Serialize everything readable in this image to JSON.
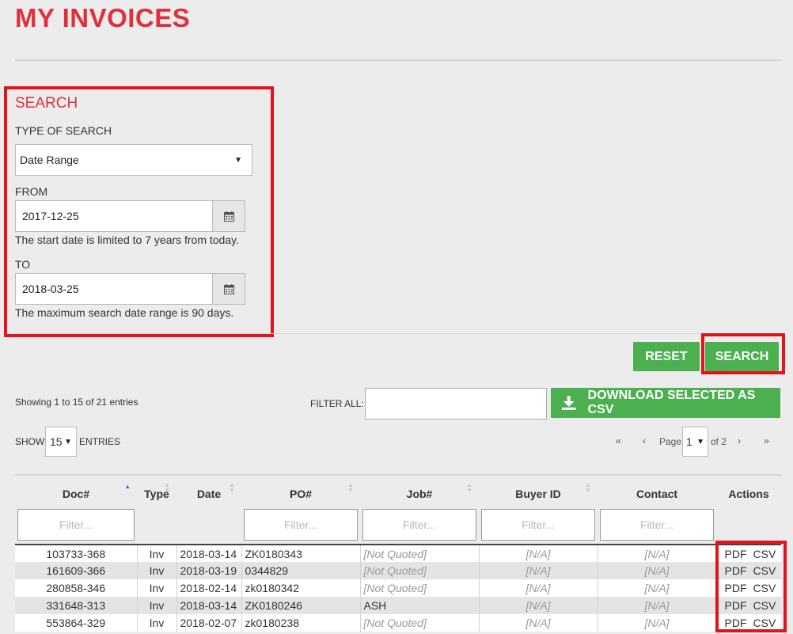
{
  "page": {
    "title": "MY INVOICES"
  },
  "search": {
    "heading": "SEARCH",
    "type_label": "TYPE OF SEARCH",
    "type_value": "Date Range",
    "from_label": "FROM",
    "from_value": "2017-12-25",
    "from_help": "The start date is limited to 7 years from today.",
    "to_label": "TO",
    "to_value": "2018-03-25",
    "to_help": "The maximum search date range is 90 days."
  },
  "actions": {
    "reset_label": "RESET",
    "search_label": "SEARCH"
  },
  "toolbar": {
    "showing": "Showing 1 to 15 of 21 entries",
    "filter_all_label": "FILTER ALL:",
    "filter_all_value": "",
    "download_label": "DOWNLOAD SELECTED AS CSV",
    "show_label": "SHOW",
    "show_value": "15",
    "entries_label": "ENTRIES"
  },
  "pagination": {
    "first": "«",
    "prev": "‹",
    "page_label": "Page",
    "page_value": "1",
    "of_label": "of 2",
    "next": "›",
    "last": "»"
  },
  "table": {
    "columns": [
      "Doc#",
      "Type",
      "Date",
      "PO#",
      "Job#",
      "Buyer ID",
      "Contact",
      "Actions"
    ],
    "filter_placeholder": "Filter...",
    "rows": [
      {
        "doc": "103733-368",
        "type": "Inv",
        "date": "2018-03-14",
        "po": "ZK0180343",
        "job": "[Not Quoted]",
        "buyer": "[N/A]",
        "contact": "[N/A]",
        "pdf": "PDF",
        "csv": "CSV"
      },
      {
        "doc": "161609-366",
        "type": "Inv",
        "date": "2018-03-19",
        "po": "0344829",
        "job": "[Not Quoted]",
        "buyer": "[N/A]",
        "contact": "[N/A]",
        "pdf": "PDF",
        "csv": "CSV"
      },
      {
        "doc": "280858-346",
        "type": "Inv",
        "date": "2018-02-14",
        "po": "zk0180342",
        "job": "[Not Quoted]",
        "buyer": "[N/A]",
        "contact": "[N/A]",
        "pdf": "PDF",
        "csv": "CSV"
      },
      {
        "doc": "331648-313",
        "type": "Inv",
        "date": "2018-03-14",
        "po": "ZK0180246",
        "job": "ASH",
        "buyer": "[N/A]",
        "contact": "[N/A]",
        "pdf": "PDF",
        "csv": "CSV"
      },
      {
        "doc": "553864-329",
        "type": "Inv",
        "date": "2018-02-07",
        "po": "zk0180238",
        "job": "[Not Quoted]",
        "buyer": "[N/A]",
        "contact": "[N/A]",
        "pdf": "PDF",
        "csv": "CSV"
      }
    ]
  },
  "colors": {
    "title_red": "#e0303e",
    "highlight_red": "#e3131b",
    "button_green": "#4caf50",
    "background": "#ececec"
  }
}
